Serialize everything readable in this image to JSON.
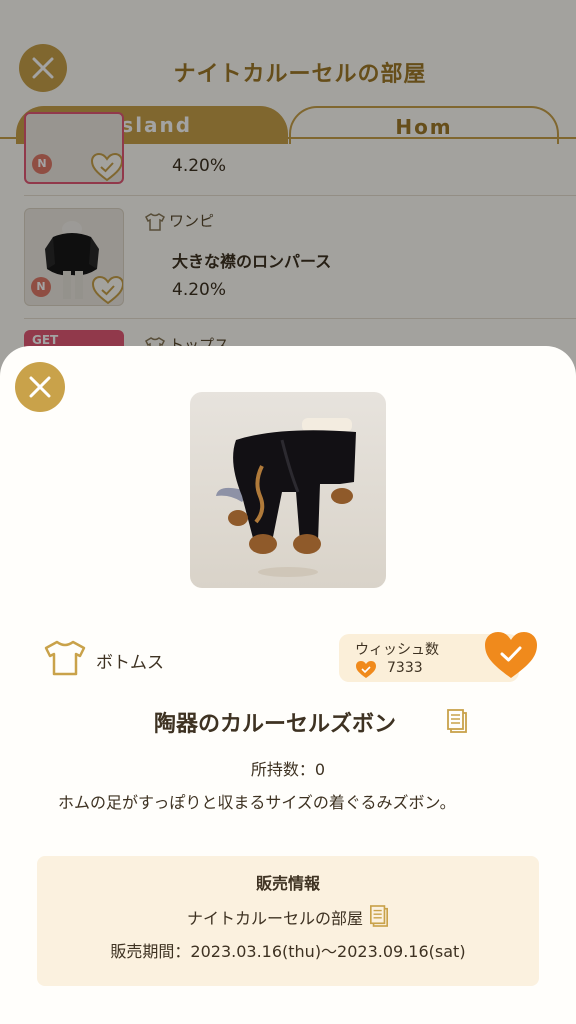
{
  "header": {
    "title": "ナイトカルーセルの部屋",
    "tabs": [
      {
        "label": "Island",
        "active": true
      },
      {
        "label": "Hom",
        "active": false
      }
    ]
  },
  "list": {
    "items": [
      {
        "category": "",
        "name": "",
        "percent": "4.20%",
        "badge": "N"
      },
      {
        "category": "ワンピ",
        "name": "大きな襟のロンパース",
        "percent": "4.20%",
        "badge": "N"
      },
      {
        "category": "トップス",
        "name": "",
        "percent": "",
        "badge": "GET"
      }
    ]
  },
  "detail": {
    "category": "ボトムス",
    "wish_label": "ウィッシュ数",
    "wish_count": "7333",
    "item_name": "陶器のカルーセルズボン",
    "owned": "所持数：0",
    "description": "ホムの足がすっぽりと収まるサイズの着ぐるみズボン。",
    "sale": {
      "title": "販売情報",
      "room": "ナイトカルーセルの部屋",
      "period": "販売期間：2023.03.16(thu)〜2023.09.16(sat)"
    }
  },
  "colors": {
    "accent_gold": "#c9a24a",
    "wish_orange": "#f08a1c",
    "new_badge": "#e07a6a",
    "get_badge": "#e35a76"
  },
  "icons": [
    "close-icon",
    "shirt-icon",
    "heart-icon",
    "check-icon",
    "copy-icon"
  ]
}
